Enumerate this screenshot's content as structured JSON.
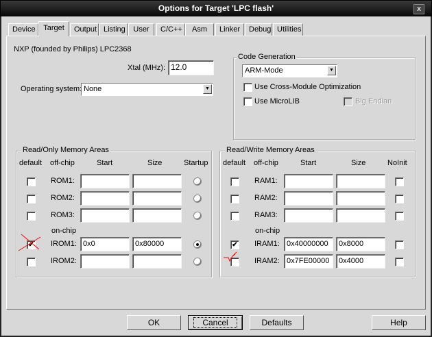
{
  "window": {
    "title": "Options for Target 'LPC flash'",
    "close_label": "x"
  },
  "tabs": [
    {
      "label": "Device"
    },
    {
      "label": "Target",
      "active": true
    },
    {
      "label": "Output"
    },
    {
      "label": "Listing"
    },
    {
      "label": "User"
    },
    {
      "label": "C/C++"
    },
    {
      "label": "Asm"
    },
    {
      "label": "Linker"
    },
    {
      "label": "Debug"
    },
    {
      "label": "Utilities"
    }
  ],
  "target": {
    "device_name": "NXP (founded by Philips) LPC2368",
    "xtal_label": "Xtal (MHz):",
    "xtal_value": "12.0",
    "os_label": "Operating system:",
    "os_value": "None",
    "code_gen": {
      "title": "Code Generation",
      "mode_value": "ARM-Mode",
      "cross_module_label": "Use Cross-Module Optimization",
      "cross_module_checked": false,
      "microlib_label": "Use MicroLIB",
      "microlib_checked": false,
      "big_endian_label": "Big Endian",
      "big_endian_checked": false
    }
  },
  "rom": {
    "title": "Read/Only Memory Areas",
    "headers": {
      "default": "default",
      "offchip": "off-chip",
      "start": "Start",
      "size": "Size",
      "startup": "Startup"
    },
    "onchip_label": "on-chip",
    "rows": [
      {
        "label": "ROM1:",
        "default": false,
        "start": "",
        "size": "",
        "startup": false
      },
      {
        "label": "ROM2:",
        "default": false,
        "start": "",
        "size": "",
        "startup": false
      },
      {
        "label": "ROM3:",
        "default": false,
        "start": "",
        "size": "",
        "startup": false
      },
      {
        "label": "IROM1:",
        "default": true,
        "start": "0x0",
        "size": "0x80000",
        "startup": true
      },
      {
        "label": "IROM2:",
        "default": false,
        "start": "",
        "size": "",
        "startup": false
      }
    ]
  },
  "ram": {
    "title": "Read/Write Memory Areas",
    "headers": {
      "default": "default",
      "offchip": "off-chip",
      "start": "Start",
      "size": "Size",
      "noinit": "NoInit"
    },
    "onchip_label": "on-chip",
    "rows": [
      {
        "label": "RAM1:",
        "default": false,
        "start": "",
        "size": "",
        "noinit": false
      },
      {
        "label": "RAM2:",
        "default": false,
        "start": "",
        "size": "",
        "noinit": false
      },
      {
        "label": "RAM3:",
        "default": false,
        "start": "",
        "size": "",
        "noinit": false
      },
      {
        "label": "IRAM1:",
        "default": true,
        "start": "0x40000000",
        "size": "0x8000",
        "noinit": false
      },
      {
        "label": "IRAM2:",
        "default": false,
        "start": "0x7FE00000",
        "size": "0x4000",
        "noinit": false
      }
    ]
  },
  "buttons": {
    "ok": "OK",
    "cancel": "Cancel",
    "defaults": "Defaults",
    "help": "Help"
  },
  "annotation_color": "#ff0000"
}
